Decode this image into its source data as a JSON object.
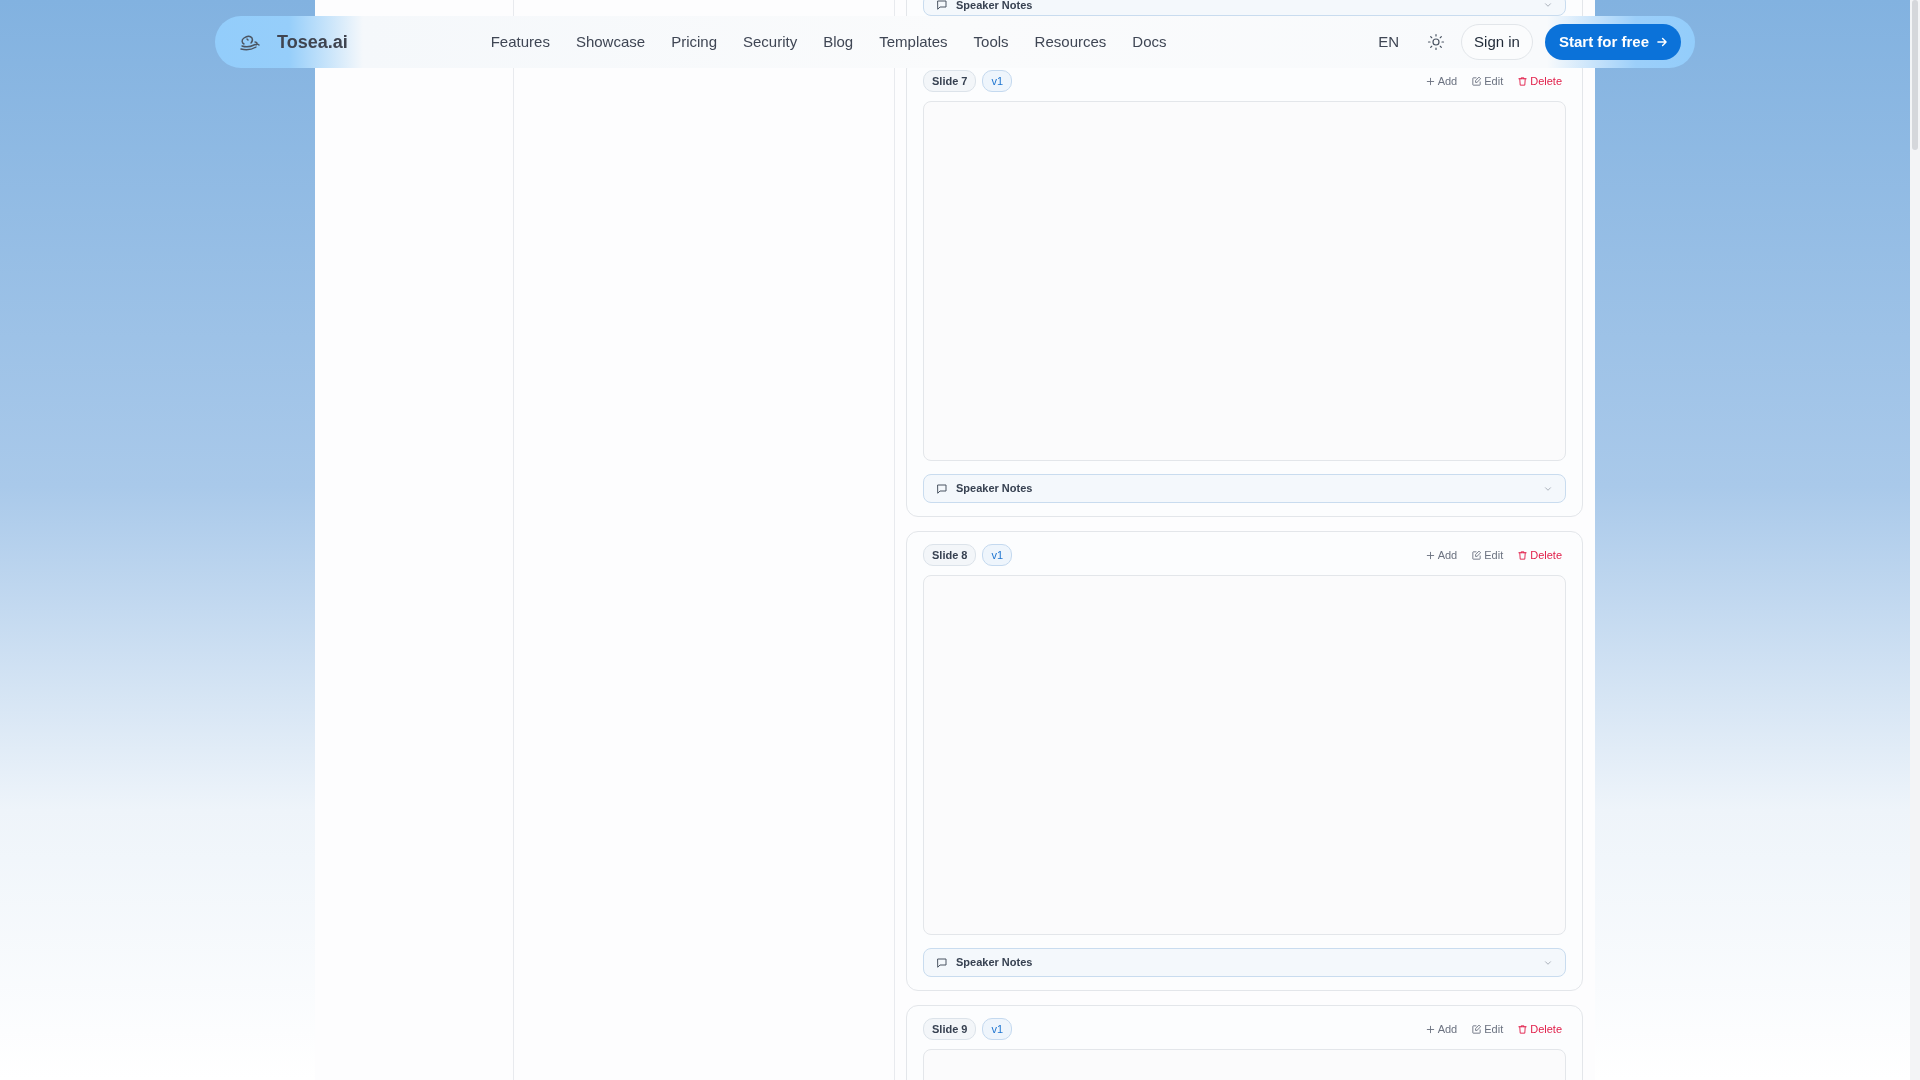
{
  "navbar": {
    "brand": "Tosea.ai",
    "links": [
      {
        "label": "Features"
      },
      {
        "label": "Showcase"
      },
      {
        "label": "Pricing"
      },
      {
        "label": "Security"
      },
      {
        "label": "Blog"
      },
      {
        "label": "Templates"
      },
      {
        "label": "Tools"
      },
      {
        "label": "Resources"
      },
      {
        "label": "Docs"
      }
    ],
    "language": "EN",
    "sign_in": "Sign in",
    "cta": "Start for free"
  },
  "slides": [
    {
      "kind": "tail",
      "notes": "Speaker Notes"
    },
    {
      "kind": "full",
      "label": "Slide 7",
      "version": "v1",
      "actions": [
        {
          "kind": "add",
          "label": "Add"
        },
        {
          "kind": "edit",
          "label": "Edit"
        },
        {
          "kind": "delete",
          "label": "Delete"
        }
      ],
      "notes": "Speaker Notes"
    },
    {
      "kind": "full",
      "label": "Slide 8",
      "version": "v1",
      "actions": [
        {
          "kind": "add",
          "label": "Add"
        },
        {
          "kind": "edit",
          "label": "Edit"
        },
        {
          "kind": "delete",
          "label": "Delete"
        }
      ],
      "notes": "Speaker Notes"
    },
    {
      "kind": "head",
      "label": "Slide 9",
      "version": "v1",
      "actions": [
        {
          "kind": "add",
          "label": "Add"
        },
        {
          "kind": "edit",
          "label": "Edit"
        },
        {
          "kind": "delete",
          "label": "Delete"
        }
      ]
    }
  ]
}
